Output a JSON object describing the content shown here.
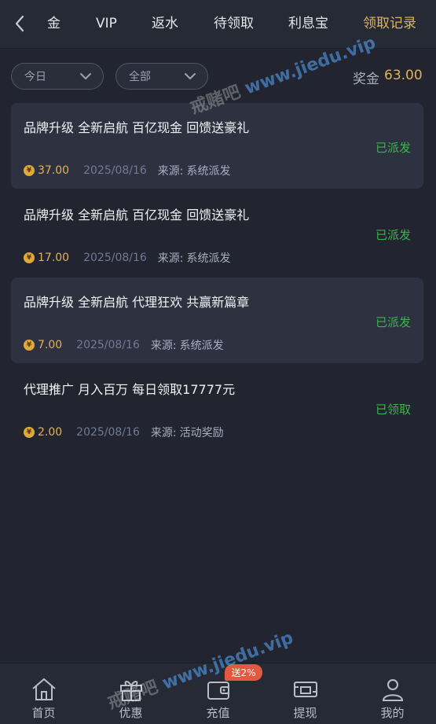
{
  "nav": {
    "tabs": [
      {
        "label": "金"
      },
      {
        "label": "VIP"
      },
      {
        "label": "返水"
      },
      {
        "label": "待领取"
      },
      {
        "label": "利息宝"
      },
      {
        "label": "领取记录"
      }
    ],
    "active_tab": "领取记录"
  },
  "filters": {
    "date": "今日",
    "type": "全部"
  },
  "bonus": {
    "label": "奖金",
    "value": "63.00"
  },
  "records": [
    {
      "title": "品牌升级 全新启航 百亿现金 回馈送豪礼",
      "status": "已派发",
      "amount": "37.00",
      "date": "2025/08/16",
      "source_label": "来源:",
      "source": "系统派发"
    },
    {
      "title": "品牌升级 全新启航 百亿现金 回馈送豪礼",
      "status": "已派发",
      "amount": "17.00",
      "date": "2025/08/16",
      "source_label": "来源:",
      "source": "系统派发"
    },
    {
      "title": "品牌升级 全新启航 代理狂欢 共赢新篇章",
      "status": "已派发",
      "amount": "7.00",
      "date": "2025/08/16",
      "source_label": "来源:",
      "source": "系统派发"
    },
    {
      "title": "代理推广 月入百万 每日领取17777元",
      "status": "已领取",
      "amount": "2.00",
      "date": "2025/08/16",
      "source_label": "来源:",
      "source": "活动奖励"
    }
  ],
  "bottom_nav": {
    "items": [
      {
        "label": "首页",
        "icon": "home-icon"
      },
      {
        "label": "优惠",
        "icon": "gift-icon"
      },
      {
        "label": "充值",
        "icon": "wallet-icon"
      },
      {
        "label": "提现",
        "icon": "withdraw-icon"
      },
      {
        "label": "我的",
        "icon": "user-icon"
      }
    ],
    "promo_badge": "送2%"
  },
  "watermark": {
    "text": "戒赌吧",
    "url": "www.jiedu.vip"
  },
  "colors": {
    "accent": "#e0b25a",
    "status_green": "#39b54a",
    "background": "#22252f"
  }
}
